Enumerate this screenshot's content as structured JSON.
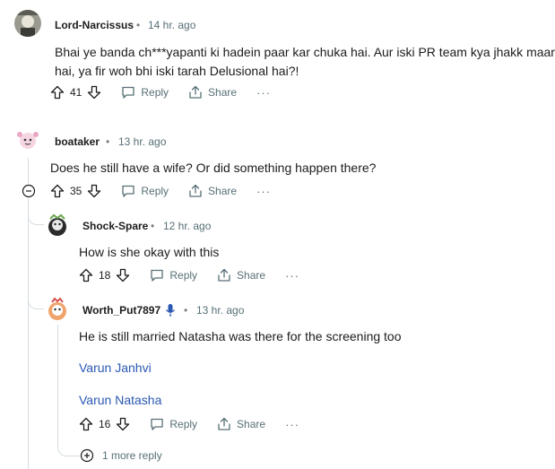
{
  "comments": [
    {
      "username": "Lord-Narcissus",
      "separator": "•",
      "time": "14 hr. ago",
      "body_line1": "Bhai ye banda ch***yapanti ki hadein paar kar chuka hai. Aur iski PR team kya jhakk maar ra",
      "body_line2": "hai, ya fir woh bhi iski tarah Delusional hai?!",
      "votes": "41",
      "reply_label": "Reply",
      "share_label": "Share",
      "more_label": "···"
    },
    {
      "username": "boataker",
      "separator": "•",
      "time": "13 hr. ago",
      "body": "Does he still have a wife? Or did something happen there?",
      "votes": "35",
      "reply_label": "Reply",
      "share_label": "Share",
      "more_label": "···"
    },
    {
      "username": "Shock-Spare",
      "separator": "•",
      "time": "12 hr. ago",
      "body": "How is she okay with this",
      "votes": "18",
      "reply_label": "Reply",
      "share_label": "Share",
      "more_label": "···"
    },
    {
      "username": "Worth_Put7897",
      "separator": "•",
      "time": "13 hr. ago",
      "body": "He is still married Natasha was there for the screening too",
      "link1": "Varun Janhvi",
      "link2": "Varun Natasha",
      "votes": "16",
      "reply_label": "Reply",
      "share_label": "Share",
      "more_label": "···"
    }
  ],
  "more_replies_label": "1 more reply",
  "colors": {
    "link": "#2a58b3",
    "meta": "#576f76",
    "thread": "#d5dde1"
  }
}
